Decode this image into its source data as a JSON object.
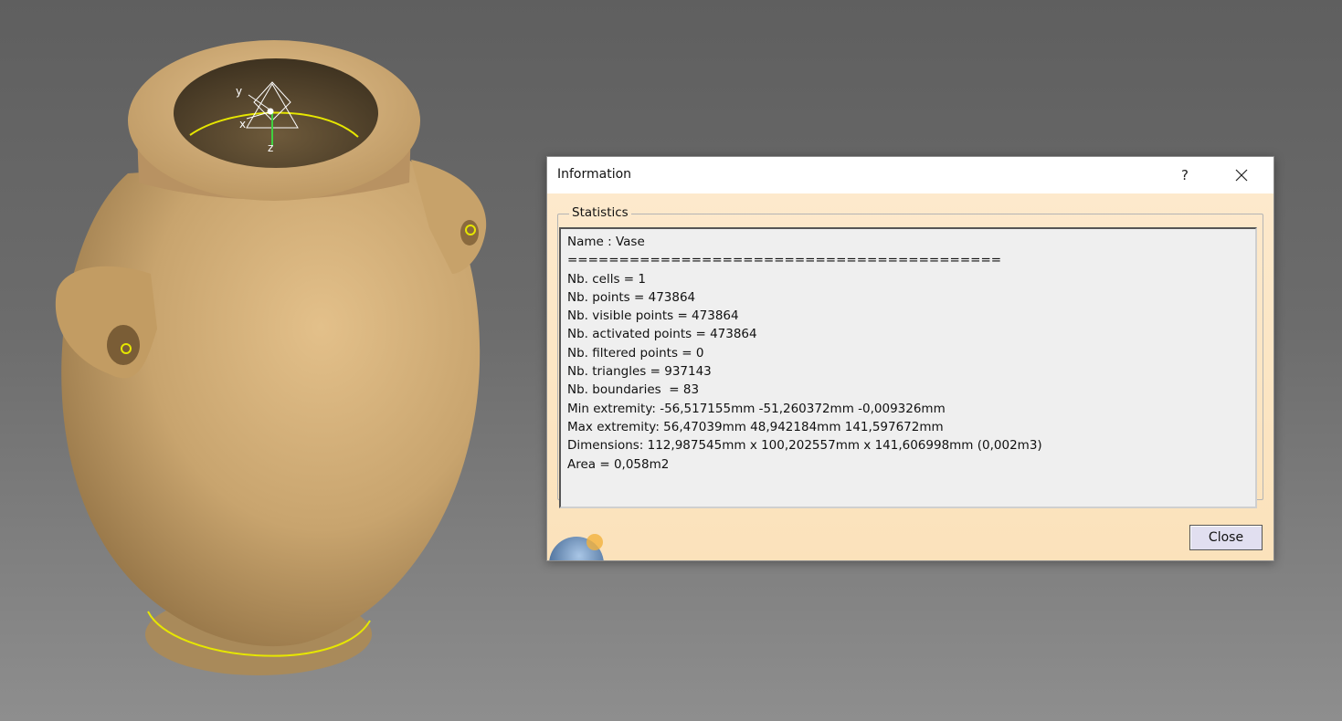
{
  "window": {
    "title": "Information",
    "help_label": "?",
    "close_icon": "close-icon"
  },
  "statistics": {
    "group_label": "Statistics",
    "lines": [
      "Name : Vase",
      "==========================================",
      "Nb. cells = 1",
      "Nb. points = 473864",
      "Nb. visible points = 473864",
      "Nb. activated points = 473864",
      "Nb. filtered points = 0",
      "Nb. triangles = 937143",
      "Nb. boundaries  = 83",
      "Min extremity: -56,517155mm -51,260372mm -0,009326mm",
      "Max extremity: 56,47039mm 48,942184mm 141,597672mm",
      "Dimensions: 112,987545mm x 100,202557mm x 141,606998mm (0,002m3)",
      "Area = 0,058m2"
    ]
  },
  "buttons": {
    "close_label": "Close"
  },
  "viewport": {
    "axis_labels": {
      "x": "x",
      "y": "y",
      "z": "z"
    },
    "object_color": "#c8a46e",
    "boundary_color": "#e6e600"
  }
}
